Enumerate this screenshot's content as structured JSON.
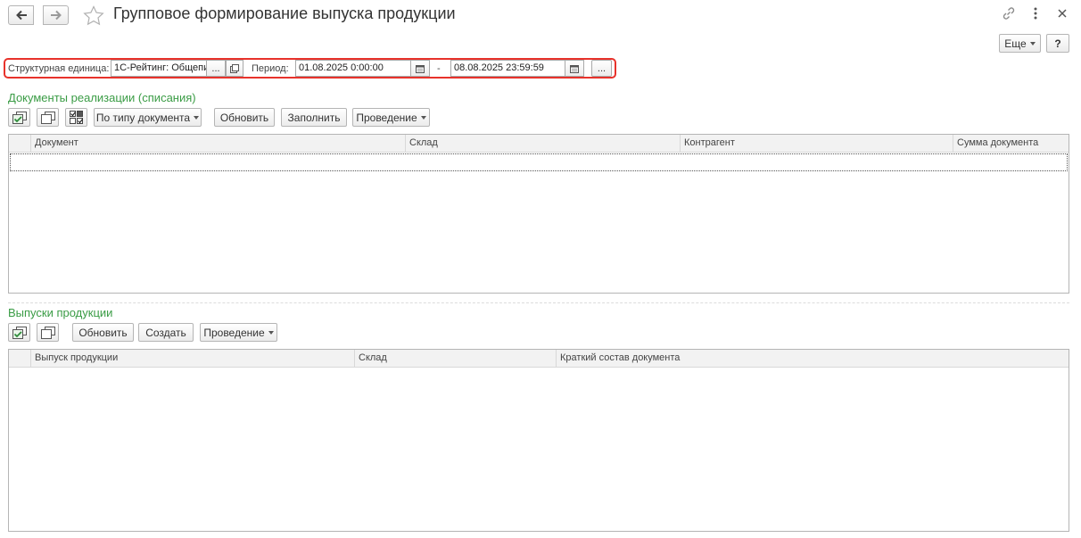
{
  "header": {
    "title": "Групповое формирование выпуска продукции",
    "more_label": "Еще",
    "help_label": "?"
  },
  "filters": {
    "unit_label": "Структурная единица:",
    "unit_value": "1С-Рейтинг: Общепи",
    "unit_select": "...",
    "period_label": "Период:",
    "period_from": "01.08.2025  0:00:00",
    "period_dash": "-",
    "period_to": "08.08.2025 23:59:59",
    "period_select": "..."
  },
  "sales_section": {
    "title": "Документы реализации (списания)",
    "toolbar": {
      "by_type_label": "По типу документа",
      "refresh_label": "Обновить",
      "fill_label": "Заполнить",
      "posting_label": "Проведение"
    },
    "columns": [
      "Документ",
      "Склад",
      "Контрагент",
      "Сумма документа"
    ],
    "rows": []
  },
  "output_section": {
    "title": "Выпуски продукции",
    "toolbar": {
      "refresh_label": "Обновить",
      "create_label": "Создать",
      "posting_label": "Проведение"
    },
    "columns": [
      "Выпуск продукции",
      "Склад",
      "Краткий состав документа"
    ],
    "rows": []
  },
  "colors": {
    "accent_green": "#3a9c45",
    "highlight_red": "#e8322b"
  },
  "icons": {
    "back": "arrow-left-icon",
    "forward": "arrow-right-icon",
    "favorite": "star-icon",
    "link": "link-icon",
    "menu": "kebab-menu-icon",
    "close": "close-icon",
    "calendar": "calendar-icon",
    "open": "open-window-icon",
    "check_all": "check-all-icon",
    "uncheck_all": "uncheck-all-icon",
    "invert": "invert-selection-icon"
  }
}
